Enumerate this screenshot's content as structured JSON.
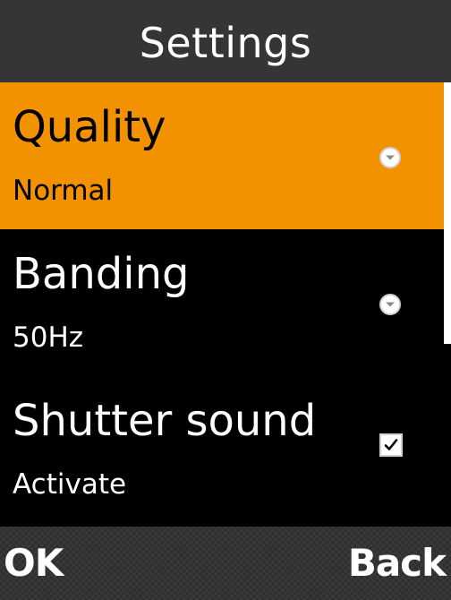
{
  "header": {
    "title": "Settings"
  },
  "settings": {
    "items": [
      {
        "label": "Quality",
        "value": "Normal",
        "control": "dropdown",
        "selected": true
      },
      {
        "label": "Banding",
        "value": "50Hz",
        "control": "dropdown",
        "selected": false
      },
      {
        "label": "Shutter sound",
        "value": "Activate",
        "control": "checkbox",
        "checked": true,
        "selected": false
      }
    ]
  },
  "softkeys": {
    "left": "OK",
    "right": "Back"
  },
  "colors": {
    "highlight": "#f39200",
    "header_bg": "#353535",
    "list_bg": "#000000",
    "softkey_bg": "#2e2e2e"
  },
  "icons": {
    "dropdown": "chevron-down-circle-icon",
    "checkbox": "checkmark-icon"
  }
}
